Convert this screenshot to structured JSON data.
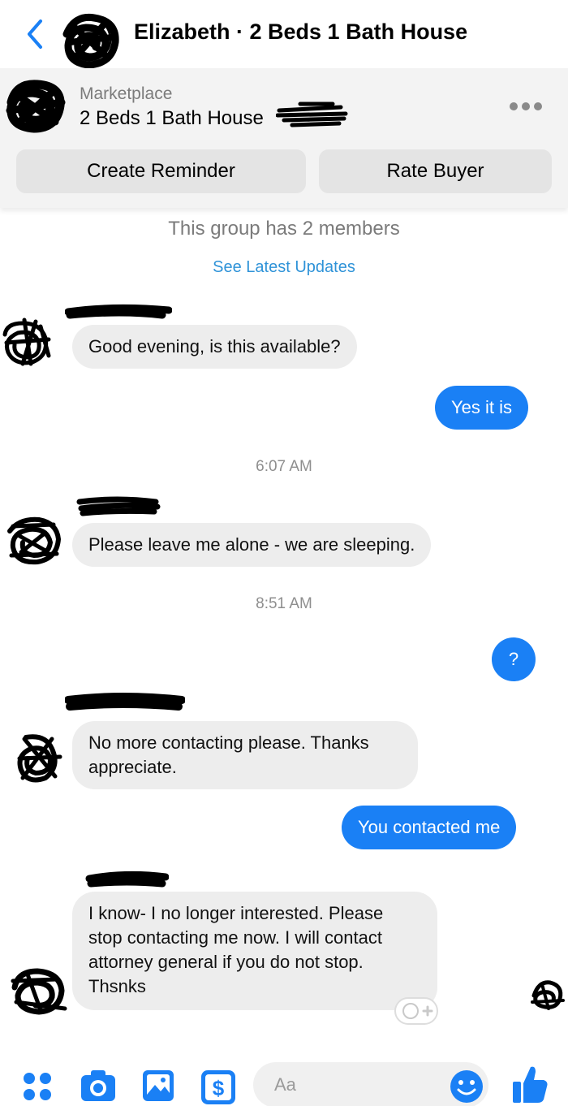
{
  "header": {
    "title": "Elizabeth · 2 Beds 1 Bath House",
    "back_icon": "chevron-left-icon",
    "accent": "#1a80f5"
  },
  "listing": {
    "kicker": "Marketplace",
    "name": "2 Beds 1 Bath House",
    "more_icon": "more-dots-icon",
    "buttons": {
      "create_reminder": "Create Reminder",
      "rate_buyer": "Rate Buyer"
    }
  },
  "thread": {
    "group_info": "This group has 2 members",
    "latest_link": "See Latest Updates",
    "timestamps": [
      "6:07 AM",
      "8:51 AM"
    ],
    "messages": [
      {
        "from": "buyer",
        "text": "Good evening, is this available?"
      },
      {
        "from": "me",
        "text": "Yes it is"
      },
      {
        "from": "buyer",
        "text": "Please leave me alone - we are sleeping."
      },
      {
        "from": "me",
        "text": "?"
      },
      {
        "from": "buyer",
        "text": "No more contacting please. Thanks appreciate."
      },
      {
        "from": "me",
        "text": "You contacted me"
      },
      {
        "from": "buyer",
        "text": "I know- I  no longer interested. Please stop contacting me now. I will contact attorney general if you do not stop. Thsnks"
      }
    ],
    "reaction_icon": "add-reaction-icon"
  },
  "composer": {
    "placeholder": "Aa",
    "icons": [
      "apps-icon",
      "camera-icon",
      "photo-icon",
      "payment-icon",
      "emoji-icon",
      "thumbs-up-icon"
    ],
    "accent": "#1a80f5"
  },
  "colors": {
    "outgoing_bubble": "#1a80f5",
    "incoming_bubble": "#ededed",
    "link": "#2f93d8",
    "muted_text": "#8e8e8e"
  }
}
